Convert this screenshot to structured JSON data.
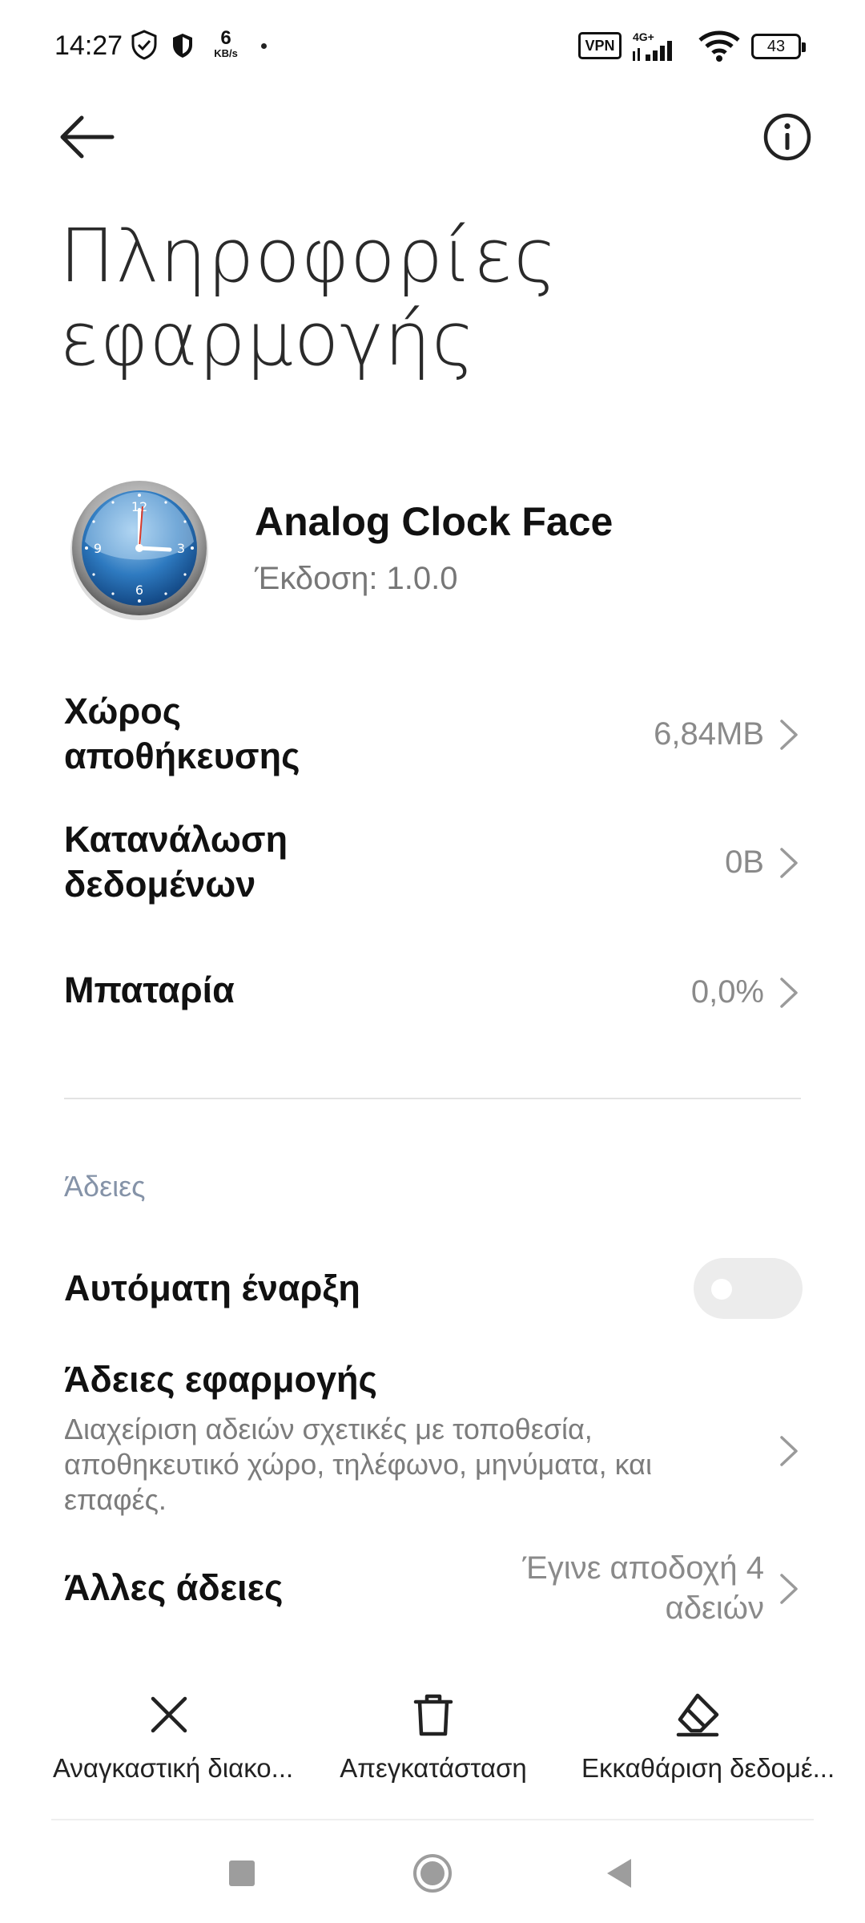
{
  "status_bar": {
    "time": "14:27",
    "net_speed_value": "6",
    "net_speed_unit": "KB/s",
    "vpn": "VPN",
    "network": "4G+",
    "battery": "43"
  },
  "header": {
    "title_line1": "Πληροφορίες",
    "title_line2": "εφαρμογής"
  },
  "app": {
    "name": "Analog Clock Face",
    "version": "Έκδοση: 1.0.0"
  },
  "rows": {
    "storage": {
      "label_line1": "Χώρος",
      "label_line2": "αποθήκευσης",
      "value": "6,84MB"
    },
    "data": {
      "label_line1": "Κατανάλωση",
      "label_line2": "δεδομένων",
      "value": "0B"
    },
    "battery": {
      "label": "Μπαταρία",
      "value": "0,0%"
    }
  },
  "permissions": {
    "section_header": "Άδειες",
    "autostart_label": "Αυτόματη έναρξη",
    "autostart_enabled": false,
    "app_permissions_label": "Άδειες εφαρμογής",
    "app_permissions_desc": "Διαχείριση αδειών σχετικές με τοποθεσία, αποθηκευτικό χώρο, τηλέφωνο, μηνύματα, και επαφές.",
    "other_label": "Άλλες άδειες",
    "other_value_line1": "Έγινε αποδοχή 4",
    "other_value_line2": "αδειών"
  },
  "actions": {
    "force_stop": "Αναγκαστική διακο...",
    "uninstall": "Απεγκατάσταση",
    "clear_data": "Εκκαθάριση δεδομέ..."
  },
  "colors": {
    "accent_section": "#8593a8",
    "secondary_text": "#8a8a8a"
  }
}
